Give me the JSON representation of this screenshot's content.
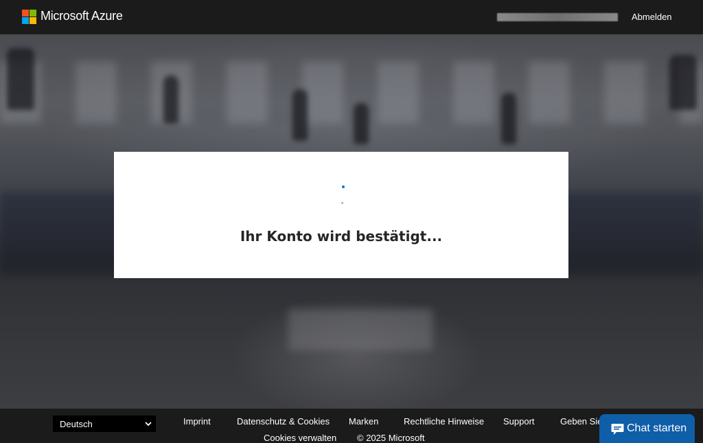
{
  "header": {
    "brand": "Microsoft Azure",
    "signout_label": "Abmelden"
  },
  "card": {
    "status_text": "Ihr Konto wird bestätigt..."
  },
  "footer": {
    "language": "Deutsch",
    "links": [
      "Imprint",
      "Datenschutz & Cookies",
      "Marken",
      "Rechtliche Hinweise",
      "Support",
      "Geben Sie",
      "Cookies verwalten",
      "© 2025 Microsoft"
    ]
  },
  "chat": {
    "label": "Chat starten"
  },
  "colors": {
    "accent": "#0078d4",
    "chat_button": "#0f5ea8",
    "header_bg": "#1b1b1b"
  }
}
